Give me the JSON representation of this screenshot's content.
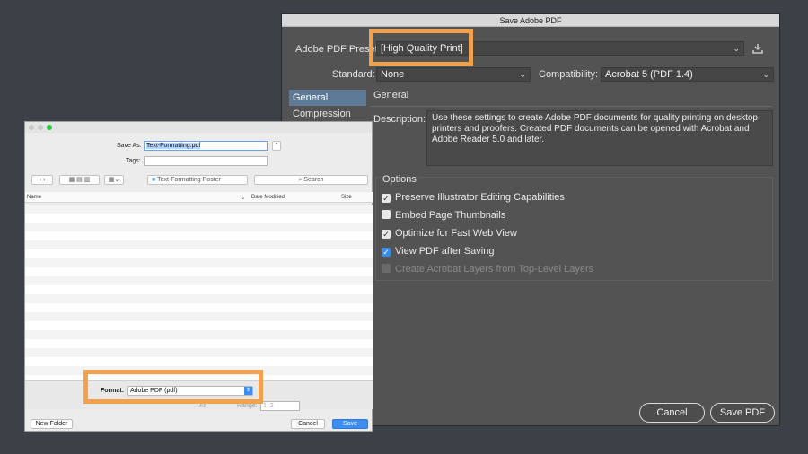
{
  "pdf_dialog": {
    "title": "Save Adobe PDF",
    "preset_label": "Adobe PDF Preset:",
    "preset_value": "[High Quality Print]",
    "standard_label": "Standard:",
    "standard_value": "None",
    "compat_label": "Compatibility:",
    "compat_value": "Acrobat 5 (PDF 1.4)",
    "sidebar": [
      {
        "label": "General"
      },
      {
        "label": "Compression"
      }
    ],
    "section_title": "General",
    "description_label": "Description:",
    "description_text": "Use these settings to create Adobe PDF documents for quality printing on desktop printers and proofers.  Created PDF documents can be opened with Acrobat and Adobe Reader 5.0 and later.",
    "options_title": "Options",
    "options": [
      {
        "label": "Preserve Illustrator Editing Capabilities",
        "checked": true
      },
      {
        "label": "Embed Page Thumbnails",
        "checked": false
      },
      {
        "label": "Optimize for Fast Web View",
        "checked": true
      },
      {
        "label": "View PDF after Saving",
        "checked": true
      },
      {
        "label": "Create Acrobat Layers from Top-Level Layers",
        "checked": false
      }
    ],
    "cancel_label": "Cancel",
    "save_label": "Save PDF"
  },
  "save_sheet": {
    "save_as_label": "Save As:",
    "filename": "Text-Formatting.pdf",
    "tags_label": "Tags:",
    "location": "Text-Formatting Poster",
    "search_placeholder": "Search",
    "col_name": "Name",
    "col_modified": "Date Modified",
    "col_size": "Size",
    "format_label": "Format:",
    "format_value": "Adobe PDF (pdf)",
    "hidden_opt_1": "All",
    "hidden_opt_2": "Range:",
    "range_value": "1–2",
    "new_folder": "New Folder",
    "cancel": "Cancel",
    "save": "Save"
  },
  "colors": {
    "highlight": "#f2a14f",
    "accent_blue": "#3a8ae8",
    "dialog_bg": "#535353"
  }
}
